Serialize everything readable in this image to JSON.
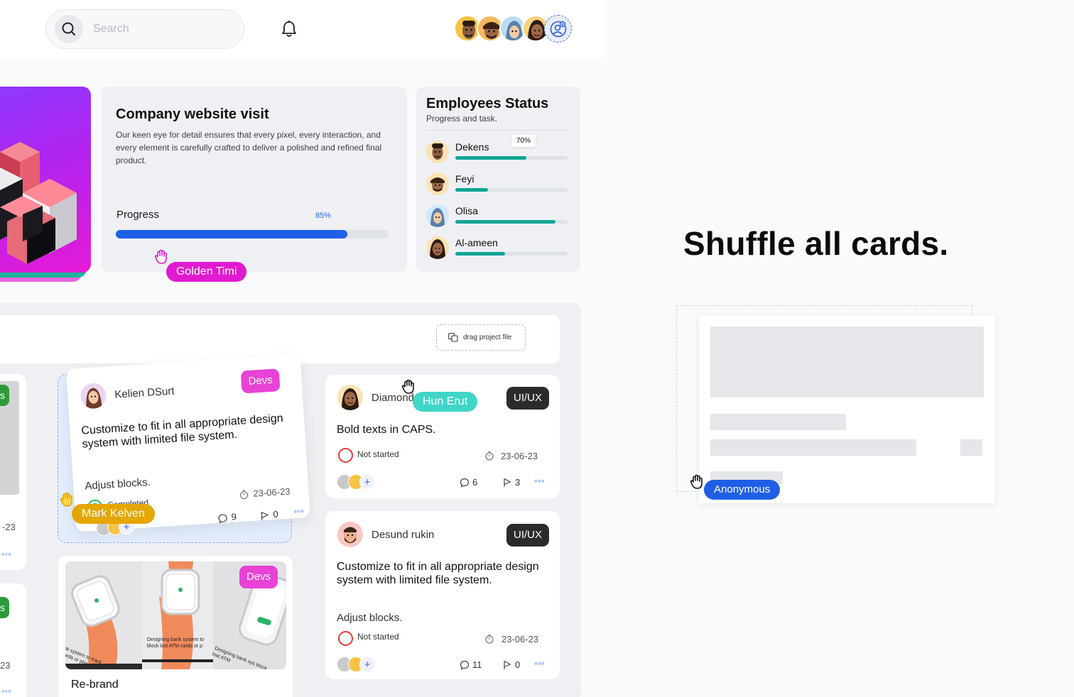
{
  "header": {
    "search_placeholder": "Search"
  },
  "company_card": {
    "title": "Company website visit",
    "description": "Our keen eye for detail ensures that every pixel, every interaction, and every element is carefully crafted to deliver a polished and refined final product.",
    "progress_label": "Progress",
    "progress_value_label": "85%",
    "progress_value": 0.85
  },
  "employees": {
    "title": "Employees Status",
    "subtitle": "Progress and task.",
    "items": [
      {
        "name": "Dekens",
        "progress": 0.63,
        "tooltip": "70%"
      },
      {
        "name": "Feyi",
        "progress": 0.29
      },
      {
        "name": "Olisa",
        "progress": 0.89
      },
      {
        "name": "Al-ameen",
        "progress": 0.44
      }
    ]
  },
  "cursors": {
    "golden": "Golden Timi",
    "mark": "Mark Kelven",
    "hun": "Hun Erut",
    "anon": "Anonymous"
  },
  "board": {
    "drag_label": "drag project file",
    "left_col": {
      "badge_top": "s",
      "date_top": "-23",
      "badge_bottom": "s",
      "date_bottom": "23"
    },
    "tilted_card": {
      "user": "Kelien DSurt",
      "tag": "Devs",
      "title": "Customize to fit in all appropriate design system with limited file system.",
      "subtitle": "Adjust blocks.",
      "status": "Completed",
      "date": "23-06-23",
      "comments": "9",
      "flags": "0"
    },
    "rebrand_card": {
      "tag": "Devs",
      "title": "Re-brand",
      "image_caption_1": "Designing bank system to block lost ATM cards or p",
      "image_caption_2": "nk system to track cards or pho",
      "image_caption_3": "Designing bank sys block lost ATM"
    },
    "card_diamond": {
      "user": "Diamond",
      "tag": "UI/UX",
      "title": "Bold texts in CAPS.",
      "status": "Not started",
      "date": "23-06-23",
      "comments": "6",
      "flags": "3"
    },
    "card_desund": {
      "user": "Desund rukin",
      "tag": "UI/UX",
      "title": "Customize to fit in all appropriate design system with limited file system.",
      "subtitle": "Adjust blocks.",
      "status": "Not started",
      "date": "23-06-23",
      "comments": "11",
      "flags": "0"
    }
  },
  "right_panel": {
    "headline": "Shuffle all cards."
  },
  "colors": {
    "accent_blue": "#2060e8",
    "teal": "#10a596",
    "magenta": "#e842d6",
    "yellow": "#e5a600"
  }
}
